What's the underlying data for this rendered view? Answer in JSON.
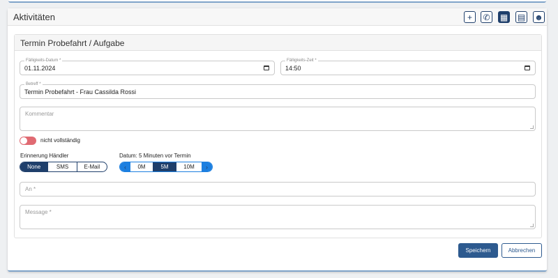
{
  "card": {
    "title": "Aktivitäten"
  },
  "header_buttons": [
    {
      "icon": "plus-icon",
      "glyph": "+"
    },
    {
      "icon": "phone-call-icon",
      "glyph": "✆"
    },
    {
      "icon": "calendar-icon",
      "glyph": "▦"
    },
    {
      "icon": "task-calendar-icon",
      "glyph": "▤"
    },
    {
      "icon": "contact-card-icon",
      "glyph": "☻"
    }
  ],
  "form": {
    "title": "Termin Probefahrt / Aufgabe",
    "due_date": {
      "label": "Fälligkeits-Datum *",
      "value": "01.11.2024"
    },
    "due_time": {
      "label": "Fälligkeits-Zeit *",
      "value": "14:50"
    },
    "subject": {
      "label": "Betreff *",
      "value": "Termin Probefahrt - Frau Cassilda Rossi"
    },
    "comment": {
      "placeholder": "Kommentar"
    },
    "toggle": {
      "label": "nicht vollständig"
    },
    "reminder": {
      "label": "Erinnerung Händler",
      "options": [
        "None",
        "SMS",
        "E-Mail"
      ],
      "selected": "None"
    },
    "timing": {
      "label": "Datum: 5 Minuten vor Termin",
      "options": [
        "0M",
        "5M",
        "10M"
      ],
      "selected": "5M",
      "prev_glyph": "‹",
      "next_glyph": "›"
    },
    "to": {
      "placeholder": "An *"
    },
    "message": {
      "placeholder": "Message *"
    }
  },
  "actions": {
    "save": "Speichern",
    "cancel": "Abbrechen"
  }
}
